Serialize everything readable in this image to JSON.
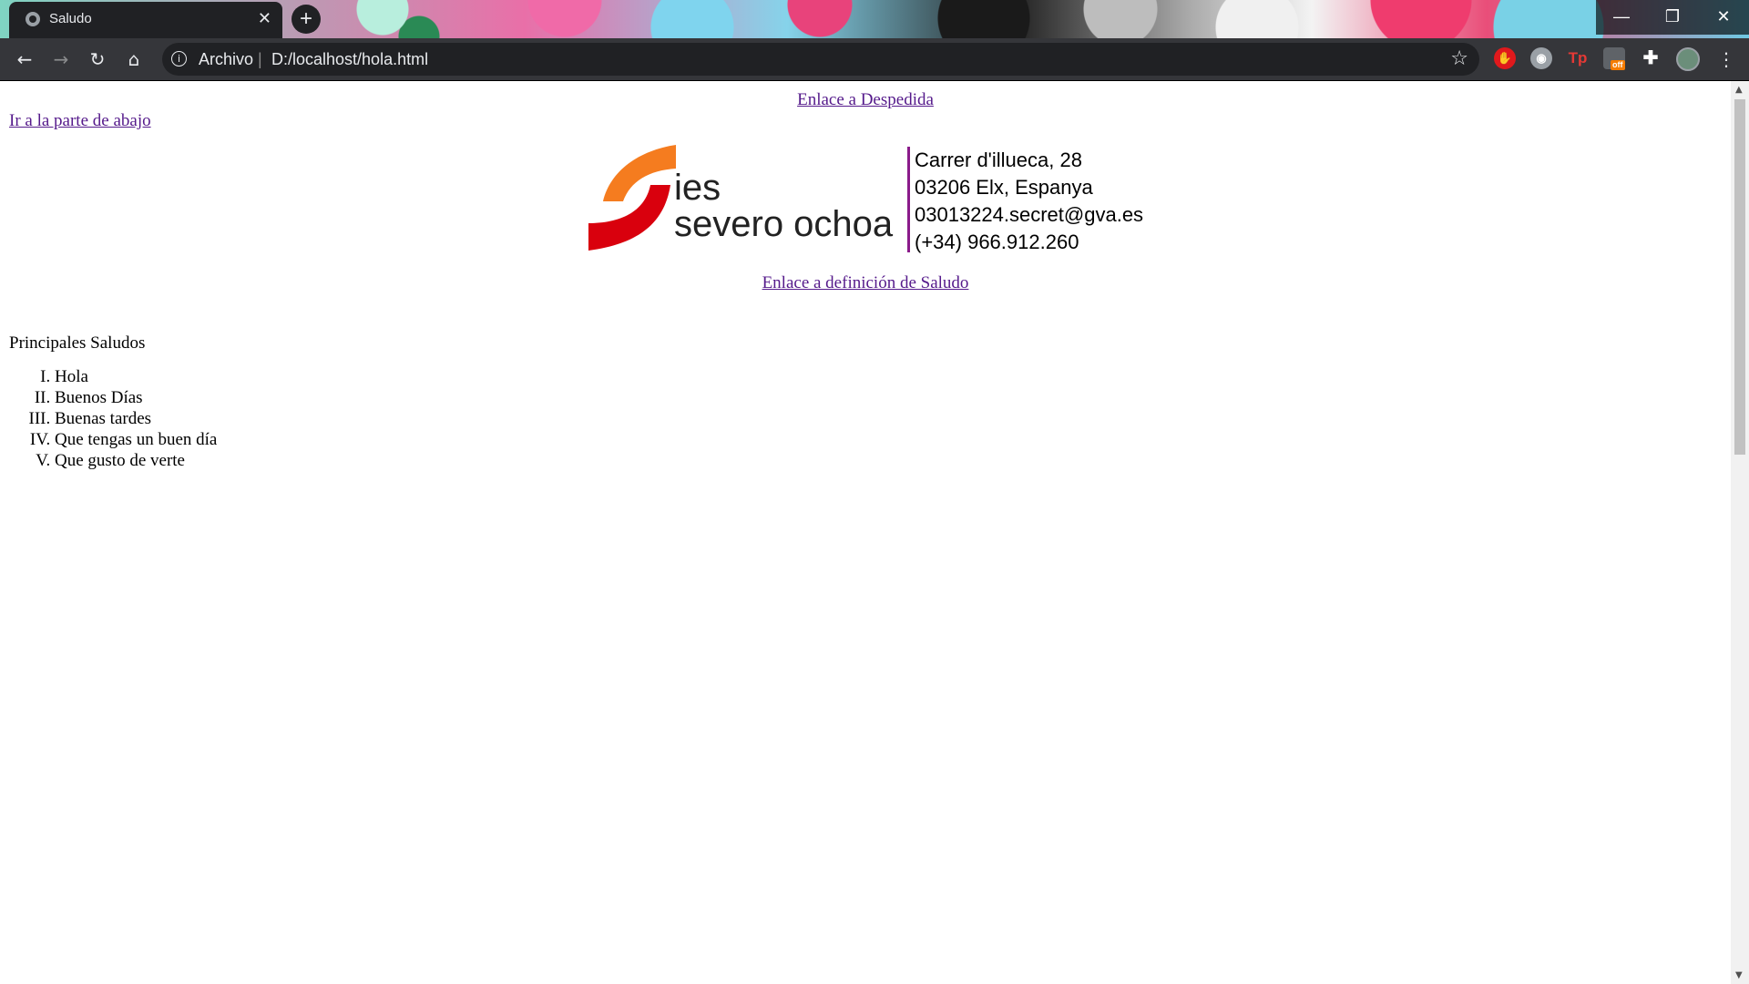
{
  "browser": {
    "tab_title": "Saludo",
    "tab_close": "✕",
    "new_tab": "+",
    "url_scheme_label": "Archivo",
    "url_separator": "|",
    "url": "D:/localhost/hola.html",
    "icons": [
      "back-icon",
      "forward-icon",
      "reload-icon",
      "home-icon",
      "site-info-icon",
      "bookmark-star-icon",
      "adblock-extension-icon",
      "discord-extension-icon",
      "tp-extension-icon",
      "off-extension-icon",
      "extensions-puzzle-icon",
      "profile-avatar-icon",
      "menu-kebab-icon"
    ],
    "ext_off_badge": "off",
    "ext_tp_label": "Tp"
  },
  "window_controls": {
    "minimize": "—",
    "restore": "❐",
    "close": "✕"
  },
  "page": {
    "link_despedida": "Enlace a Despedida",
    "link_abajo": "Ir a la parte de abajo",
    "logo": {
      "name_line1": "ies",
      "name_line2": "severo ochoa",
      "address_line1": "Carrer d'illueca, 28",
      "address_line2": "03206 Elx, Espanya",
      "email": "03013224.secret@gva.es",
      "phone": "(+34) 966.912.260",
      "colors": {
        "orange": "#f57c1f",
        "red": "#d9000d",
        "divider": "#8a1b8a"
      }
    },
    "link_saludo": "Enlace a definición de Saludo",
    "list_heading": "Principales Saludos",
    "saludos": [
      "Hola",
      "Buenos Días",
      "Buenas tardes",
      "Que tengas un buen día",
      "Que gusto de verte"
    ]
  },
  "colors": {
    "link_visited": "#551a8b",
    "toolbar": "#35363a",
    "omnibox": "#202124"
  }
}
